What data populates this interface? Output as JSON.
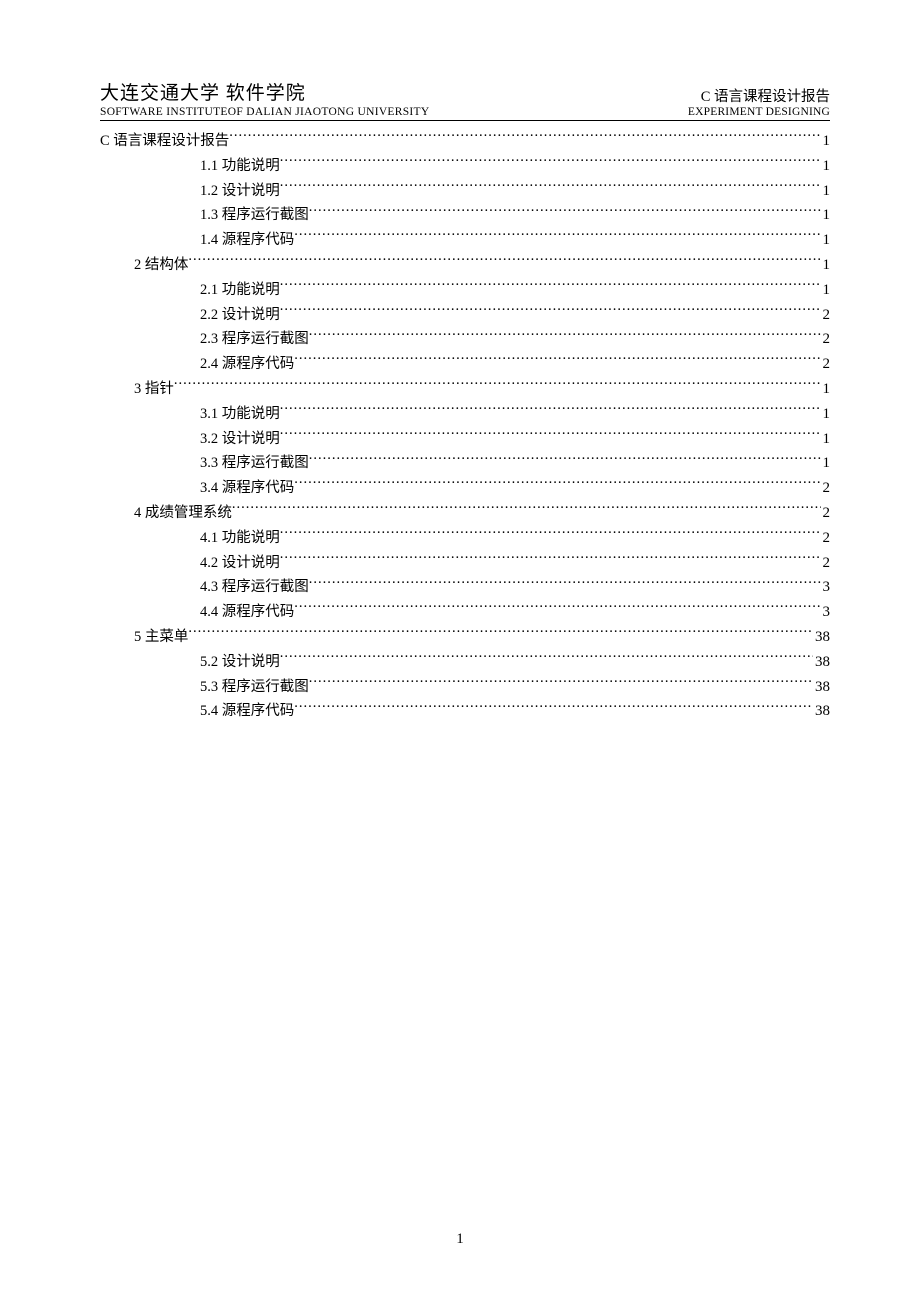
{
  "header": {
    "left": {
      "title": "大连交通大学  软件学院",
      "sub": "SOFTWARE INSTITUTEOF DALIAN JIAOTONG UNIVERSITY"
    },
    "right": {
      "title": "C 语言课程设计报告",
      "sub": "EXPERIMENT DESIGNING"
    }
  },
  "toc": [
    {
      "level": 1,
      "label": "C 语言课程设计报告",
      "page": "1"
    },
    {
      "level": 3,
      "label": "1.1 功能说明",
      "page": "1"
    },
    {
      "level": 3,
      "label": "1.2  设计说明",
      "page": "1"
    },
    {
      "level": 3,
      "label": "1.3  程序运行截图",
      "page": "1"
    },
    {
      "level": 3,
      "label": "1.4 源程序代码",
      "page": "1"
    },
    {
      "level": 2,
      "label": "2  结构体",
      "page": "1"
    },
    {
      "level": 3,
      "label": "2.1  功能说明",
      "page": "1"
    },
    {
      "level": 3,
      "label": "2.2  设计说明",
      "page": "2"
    },
    {
      "level": 3,
      "label": "2.3  程序运行截图",
      "page": "2"
    },
    {
      "level": 3,
      "label": "2.4  源程序代码",
      "page": "2"
    },
    {
      "level": 2,
      "label": "3 指针",
      "page": "1"
    },
    {
      "level": 3,
      "label": "3.1  功能说明",
      "page": "1"
    },
    {
      "level": 3,
      "label": "3.2  设计说明",
      "page": "1"
    },
    {
      "level": 3,
      "label": "3.3  程序运行截图",
      "page": "1"
    },
    {
      "level": 3,
      "label": "3.4  源程序代码",
      "page": "2"
    },
    {
      "level": 2,
      "label": "4 成绩管理系统",
      "page": "2"
    },
    {
      "level": 3,
      "label": "4.1  功能说明",
      "page": "2"
    },
    {
      "level": 3,
      "label": "4.2  设计说明",
      "page": "2"
    },
    {
      "level": 3,
      "label": "4.3  程序运行截图",
      "page": "3"
    },
    {
      "level": 3,
      "label": "4.4  源程序代码",
      "page": "3"
    },
    {
      "level": 2,
      "label": "5  主菜单",
      "page": "38"
    },
    {
      "level": 3,
      "label": "5.2  设计说明",
      "page": "38"
    },
    {
      "level": 3,
      "label": "5.3  程序运行截图",
      "page": "38"
    },
    {
      "level": 3,
      "label": "5.4  源程序代码",
      "page": "38"
    }
  ],
  "footer": {
    "page_number": "1"
  }
}
